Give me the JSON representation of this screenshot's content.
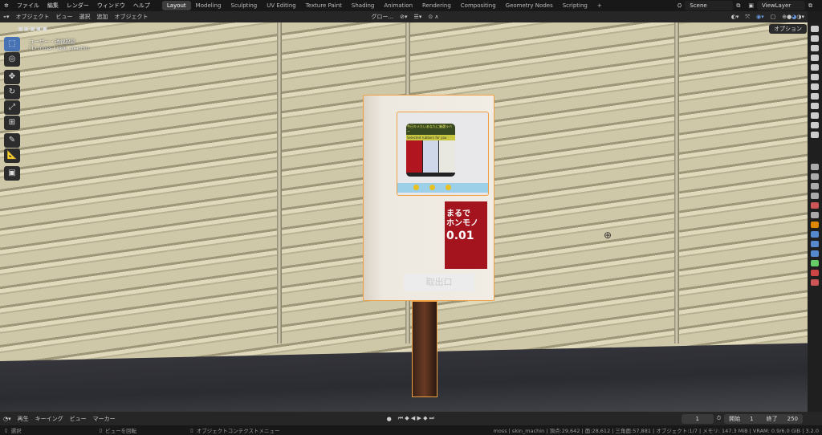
{
  "menu": [
    "ファイル",
    "編集",
    "レンダー",
    "ウィンドウ",
    "ヘルプ"
  ],
  "workspaces": [
    "Layout",
    "Modeling",
    "Sculpting",
    "UV Editing",
    "Texture Paint",
    "Shading",
    "Animation",
    "Rendering",
    "Compositing",
    "Geometry Nodes",
    "Scripting",
    "+"
  ],
  "scene": "Scene",
  "view_layer": "ViewLayer",
  "header": {
    "mode": "オブジェクト",
    "items": [
      "ビュー",
      "選択",
      "追加",
      "オブジェクト"
    ],
    "orientation": "グロー...",
    "options": "オプション"
  },
  "viewport": {
    "view_name": "ユーザー・透視投影",
    "object_info": "(1) moss | skin_machin"
  },
  "machine": {
    "screen_title": "今日キメたいあなたに厳選ラバー",
    "screen_sub": "Selected rubbers for you",
    "ad_line1": "まるで",
    "ad_line2": "ホンモノ",
    "ad_line3": "0.01",
    "outlet": "取出口"
  },
  "timeline": {
    "items": [
      "再生",
      "キーイング",
      "ビュー",
      "マーカー"
    ],
    "current_frame": "1",
    "start_label": "開始",
    "start": "1",
    "end_label": "終了",
    "end": "250"
  },
  "status": {
    "select": "選択",
    "rotate": "ビューを回転",
    "context": "オブジェクトコンテクストメニュー",
    "stats": "moss | skin_machin | 頂点:29,642 | 面:28,612 | 三角面:57,881 | オブジェクト:1/7 | メモリ: 147.3 MiB | VRAM: 0.9/6.0 GiB | 3.2.0"
  },
  "colors": {
    "accent": "#4772b3",
    "selection": "#f0a040"
  }
}
